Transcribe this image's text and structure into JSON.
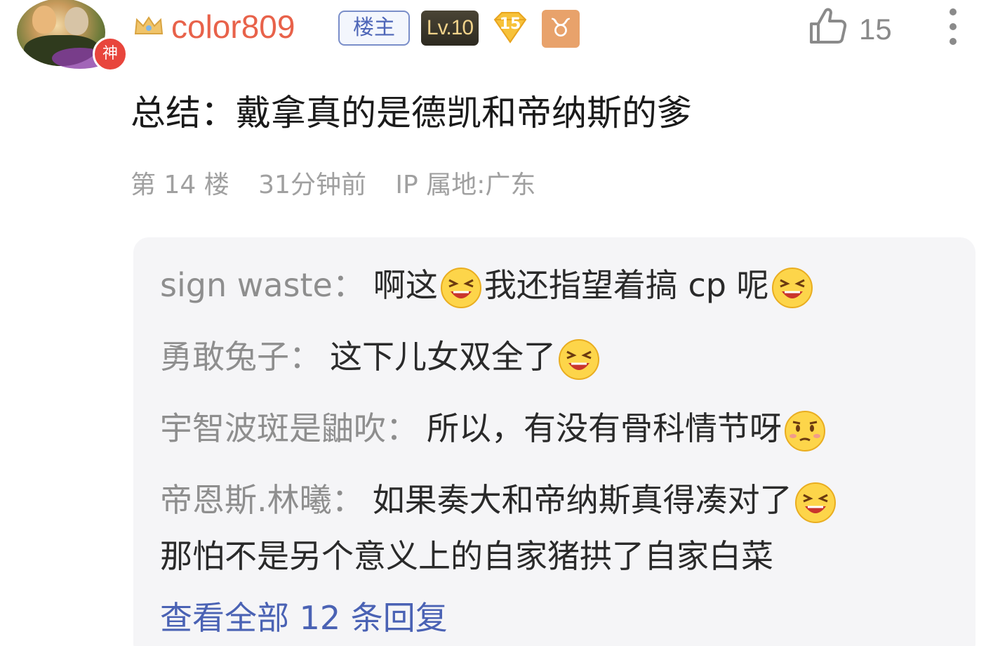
{
  "post": {
    "author": {
      "avatar_badge": "神",
      "crown_icon": "crown-icon",
      "username": "color809",
      "owner_tag": "楼主",
      "level": "Lv.10",
      "gem_level": "15",
      "zodiac_symbol": "♉",
      "colors": {
        "username": "#e8624a",
        "owner_tag": "#4e66b8",
        "zodiac_tag": "#e8a26b"
      }
    },
    "likes": "15",
    "content": "总结：戴拿真的是德凯和帝纳斯的爹",
    "meta": {
      "floor": "第 14 楼",
      "time": "31分钟前",
      "ip": "IP 属地:广东"
    }
  },
  "replies": [
    {
      "name": "sign waste",
      "sep": "：",
      "segments": [
        "啊这",
        "emoji:grin",
        "我还指望着搞 cp 呢",
        "emoji:grin"
      ]
    },
    {
      "name": "勇敢兔子",
      "sep": "：",
      "segments": [
        "这下儿女双全了",
        "emoji:grin"
      ]
    },
    {
      "name": "宇智波斑是鼬吹",
      "sep": "：",
      "segments": [
        "所以，有没有骨科情节呀",
        "emoji:shy"
      ]
    },
    {
      "name": "帝恩斯.林曦",
      "sep": "：",
      "line1": "如果奏大和帝纳斯真得凑对了",
      "line1_emoji": "emoji:grin",
      "line2": "那怕不是另个意义上的自家猪拱了自家白菜"
    }
  ],
  "view_all_replies": "查看全部 12 条回复",
  "icons": {
    "like": "thumbs-up-icon",
    "more": "more-vertical-icon",
    "grin": "grinning-emoji-icon",
    "shy": "embarrassed-emoji-icon"
  }
}
